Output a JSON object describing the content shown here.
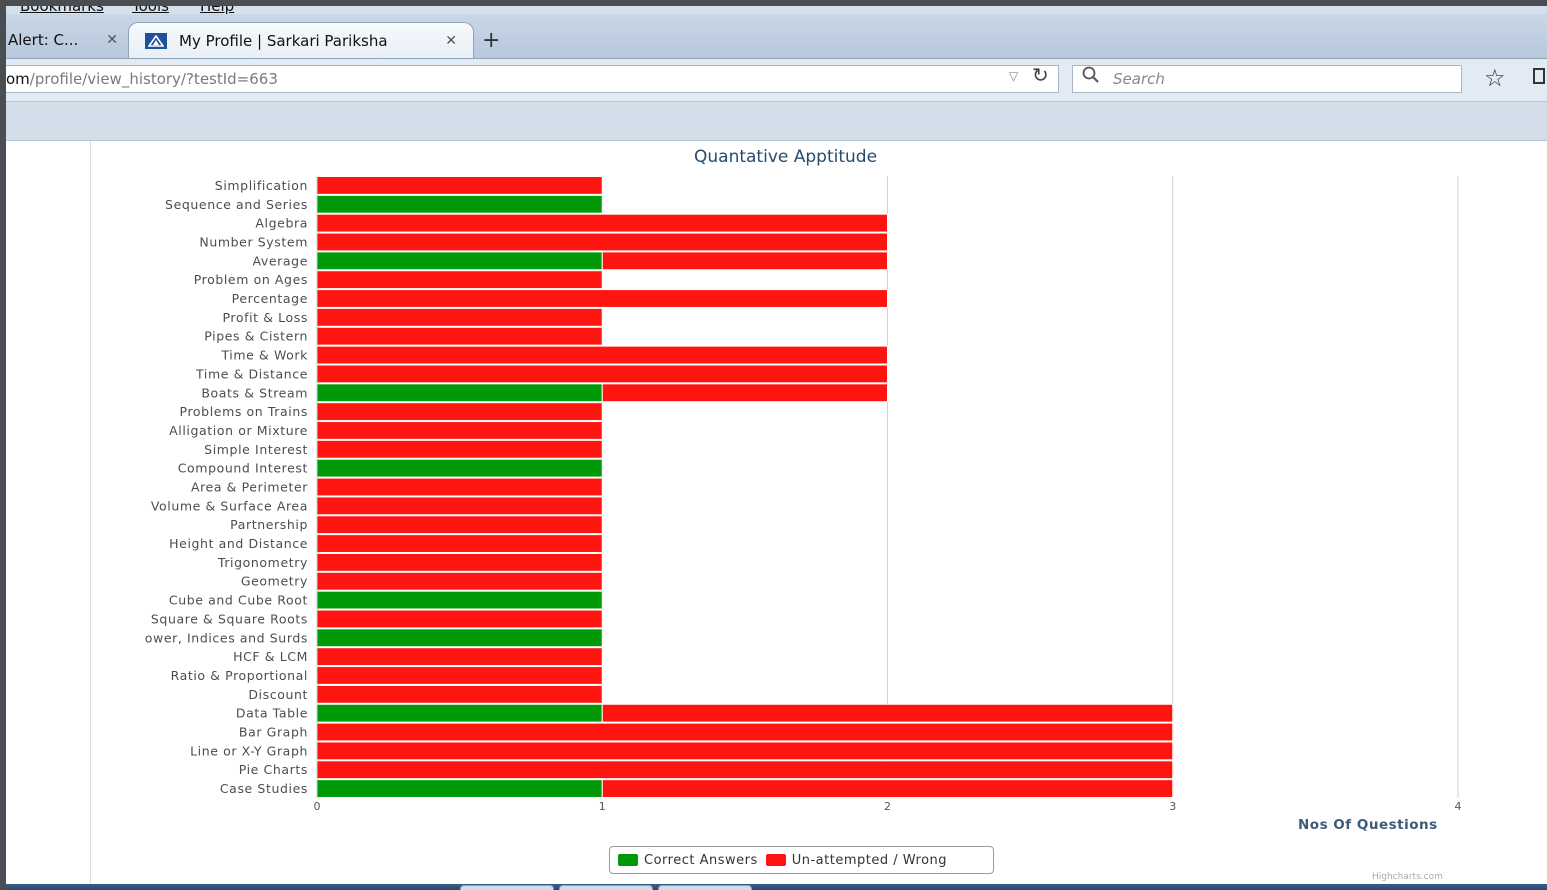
{
  "browser": {
    "menubar": [
      "Bookmarks",
      "Tools",
      "Help"
    ],
    "tabs": [
      {
        "label": "Alert: C...",
        "active": false
      },
      {
        "label": "My Profile | Sarkari Pariksha",
        "active": true
      }
    ],
    "url_domain_tail": "om",
    "url_path": "/profile/view_history/?testId=663",
    "search_placeholder": "Search"
  },
  "chart_data": {
    "type": "bar",
    "orientation": "horizontal",
    "stacked": true,
    "title": "Quantative Apptitude",
    "xlabel": "Nos Of Questions",
    "xlim": [
      0,
      4
    ],
    "x_ticks": [
      "0",
      "1",
      "2",
      "3",
      "4"
    ],
    "grid": true,
    "legend_position": "bottom-center",
    "colors": {
      "correct": "#009a09",
      "wrong": "#ff1510"
    },
    "categories": [
      "Simplification",
      "Sequence and Series",
      "Algebra",
      "Number System",
      "Average",
      "Problem on Ages",
      "Percentage",
      "Profit & Loss",
      "Pipes & Cistern",
      "Time & Work",
      "Time & Distance",
      "Boats & Stream",
      "Problems on Trains",
      "Alligation or Mixture",
      "Simple Interest",
      "Compound Interest",
      "Area & Perimeter",
      "Volume & Surface Area",
      "Partnership",
      "Height and Distance",
      "Trigonometry",
      "Geometry",
      "Cube and Cube Root",
      "Square & Square Roots",
      "ower, Indices and Surds",
      "HCF & LCM",
      "Ratio & Proportional",
      "Discount",
      "Data Table",
      "Bar Graph",
      "Line or X-Y Graph",
      "Pie Charts",
      "Case Studies"
    ],
    "series": [
      {
        "name": "Correct Answers",
        "values": [
          0,
          1,
          0,
          0,
          1,
          0,
          0,
          0,
          0,
          0,
          0,
          1,
          0,
          0,
          0,
          1,
          0,
          0,
          0,
          0,
          0,
          0,
          1,
          0,
          1,
          0,
          0,
          0,
          1,
          0,
          0,
          0,
          1
        ]
      },
      {
        "name": "Un-attempted / Wrong",
        "values": [
          1,
          0,
          2,
          2,
          1,
          1,
          2,
          1,
          1,
          2,
          2,
          1,
          1,
          1,
          1,
          0,
          1,
          1,
          1,
          1,
          1,
          1,
          0,
          1,
          0,
          1,
          1,
          1,
          2,
          3,
          3,
          3,
          2
        ]
      }
    ],
    "credit": "Highcharts.com"
  }
}
